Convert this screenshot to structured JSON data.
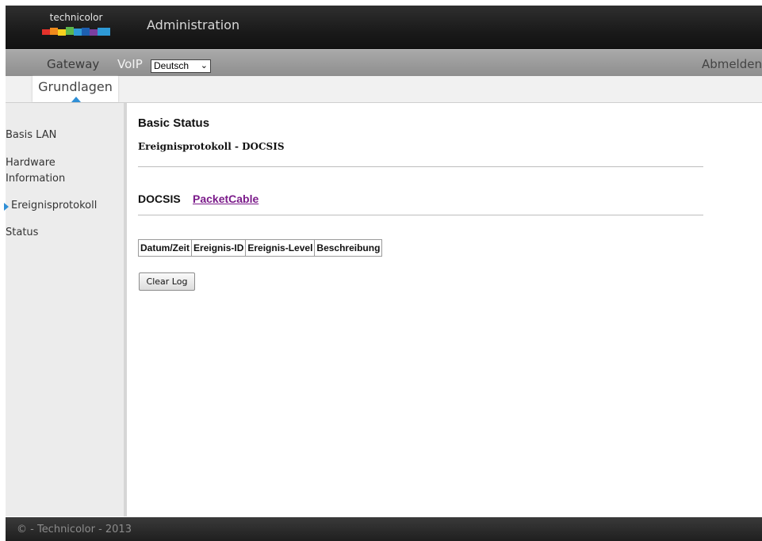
{
  "header": {
    "logo_text": "technicolor",
    "title": "Administration"
  },
  "nav": {
    "gateway": "Gateway",
    "voip": "VoIP",
    "language_selected": "Deutsch",
    "logout": "Abmelden"
  },
  "subnav": {
    "active_tab": "Grundlagen"
  },
  "sidebar": {
    "items": [
      {
        "label": "Basis LAN",
        "active": false
      },
      {
        "label": "Hardware Information",
        "active": false
      },
      {
        "label": "Ereignisprotokoll",
        "active": true
      },
      {
        "label": "Status",
        "active": false
      }
    ]
  },
  "content": {
    "title": "Basic Status",
    "subtitle": "Ereignisprotokoll - DOCSIS",
    "section_current": "DOCSIS",
    "section_link": "PacketCable",
    "table_headers": [
      "Datum/Zeit",
      "Ereignis-ID",
      "Ereignis-Level",
      "Beschreibung"
    ],
    "clear_button": "Clear Log"
  },
  "footer": {
    "copyright": "© - Technicolor - 2013"
  },
  "colors": {
    "accent": "#2f8fd6",
    "link": "#7b1b8a"
  }
}
